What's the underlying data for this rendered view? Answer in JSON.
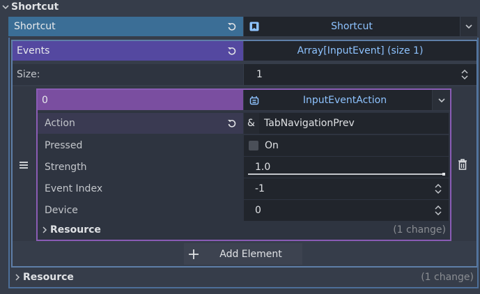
{
  "section": {
    "title": "Shortcut"
  },
  "shortcut_row": {
    "label": "Shortcut",
    "value": "Shortcut"
  },
  "events_row": {
    "label": "Events",
    "value": "Array[InputEvent] (size 1)"
  },
  "size_row": {
    "label": "Size:",
    "value": "1"
  },
  "element": {
    "index": "0",
    "type": "InputEventAction",
    "properties": {
      "action": {
        "label": "Action",
        "prefix": "&",
        "value": "TabNavigationPrev"
      },
      "pressed": {
        "label": "Pressed",
        "checkbox_label": "On",
        "checked": false
      },
      "strength": {
        "label": "Strength",
        "value": "1.0",
        "fill": 1.0
      },
      "event_index": {
        "label": "Event Index",
        "value": "-1"
      },
      "device": {
        "label": "Device",
        "value": "0"
      }
    },
    "resource": {
      "label": "Resource",
      "changes": "(1 change)"
    }
  },
  "add_element": {
    "label": "Add Element"
  },
  "resource": {
    "label": "Resource",
    "changes": "(1 change)"
  },
  "colors": {
    "background": "#363d4a",
    "shortcut_header": "#3b6e96",
    "events_header": "#5448a0",
    "element_header": "#7a4ea0",
    "value_field": "#21252c",
    "accent_text": "#8ec3ff"
  },
  "icons": [
    "chevron-down-icon",
    "revert-icon",
    "resource-icon",
    "updown-icon",
    "drag-handle-icon",
    "shortcut-type-icon",
    "trash-icon",
    "plus-icon",
    "chevron-right-icon"
  ]
}
